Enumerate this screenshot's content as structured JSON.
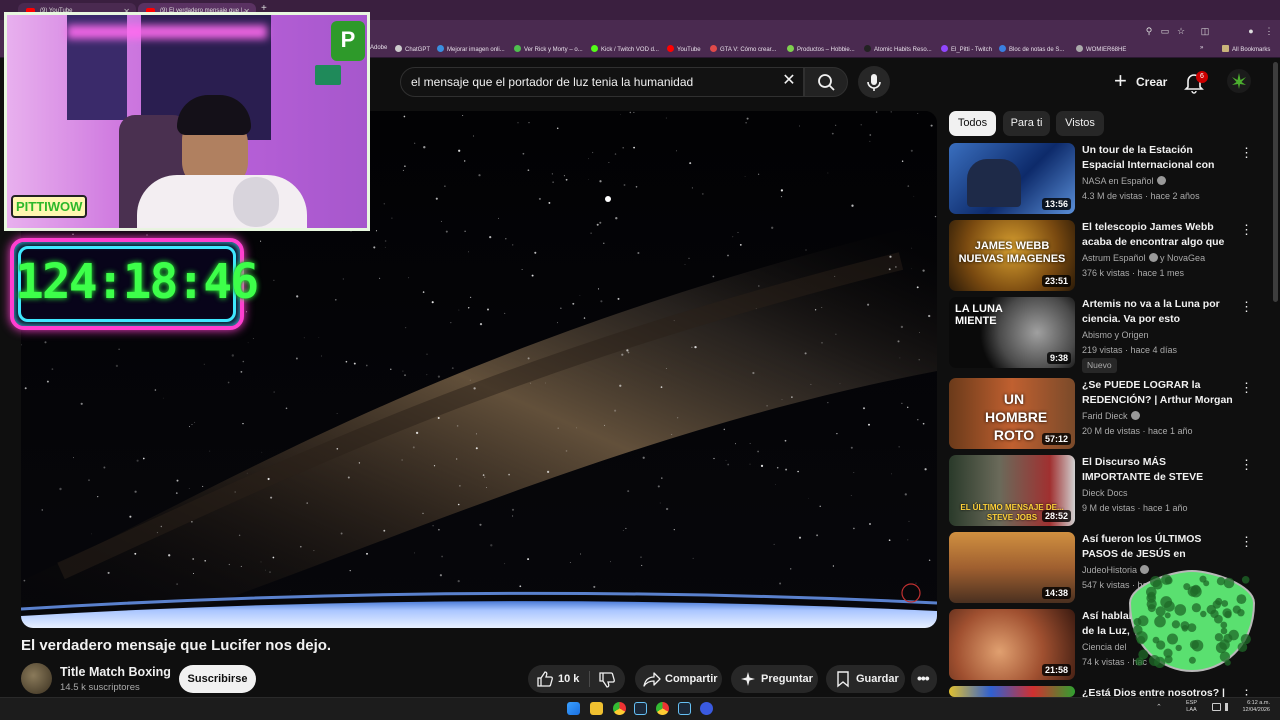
{
  "browser": {
    "tabs": [
      {
        "title": "(9) YouTube"
      },
      {
        "title": "(9) El verdadero mensaje que |..."
      }
    ],
    "bookmarks": [
      {
        "label": "Adobe",
        "color": "#e03a3a"
      },
      {
        "label": "ChatGPT",
        "color": "#cccccc"
      },
      {
        "label": "Mejorar imagen onli...",
        "color": "#3a8fe0"
      },
      {
        "label": "Ver Rick y Morty – o...",
        "color": "#4fbf4f"
      },
      {
        "label": "Kick / Twitch VOD d...",
        "color": "#53fc18"
      },
      {
        "label": "YouTube",
        "color": "#ff0000"
      },
      {
        "label": "GTA V: Cómo crear...",
        "color": "#e04a4a"
      },
      {
        "label": "Productos – Hobbie...",
        "color": "#7fd04f"
      },
      {
        "label": "Atomic Habits Reso...",
        "color": "#222222"
      },
      {
        "label": "El_Pitti - Twitch",
        "color": "#9146ff"
      },
      {
        "label": "Bloc de notas de S...",
        "color": "#3a7fe0"
      },
      {
        "label": "WOMIER68HE",
        "color": "#aaaaaa"
      }
    ],
    "all_bookmarks": "All Bookmarks"
  },
  "header": {
    "search_value": "el mensaje que el portador de luz tenia la humanidad",
    "create_label": "Crear",
    "notification_count": "6"
  },
  "video": {
    "title": "El verdadero mensaje que Lucifer nos dejo.",
    "channel": "Title Match Boxing",
    "subscribers": "14.5 k suscriptores",
    "subscribe_label": "Suscribirse",
    "likes": "10 k",
    "share_label": "Compartir",
    "ask_label": "Preguntar",
    "save_label": "Guardar"
  },
  "chips": [
    "Todos",
    "Para ti",
    "Vistos"
  ],
  "recommendations": [
    {
      "title": "Un tour de la Estación Espacial Internacional con Frank Rubio",
      "channel": "NASA en Español",
      "verified": true,
      "meta": "4.3 M de vistas · hace 2 años",
      "duration": "13:56",
      "thumb_overlay": ""
    },
    {
      "title": "El telescopio James Webb acaba de encontrar algo que N...",
      "channel": "Astrum Español",
      "verified": true,
      "channel_extra": "y NovaGea",
      "meta": "376 k vistas · hace 1 mes",
      "duration": "23:51",
      "thumb_overlay": "JAMES WEBB NUEVAS IMAGENES"
    },
    {
      "title": "Artemis no va a la Luna por ciencia.  Va por esto",
      "channel": "Abismo y Origen",
      "verified": false,
      "meta": "219 vistas · hace 4 días",
      "duration": "9:38",
      "badge": "Nuevo",
      "thumb_overlay": "LA LUNA MIENTE"
    },
    {
      "title": "¿Se PUEDE LOGRAR la REDENCIÓN? | Arthur Morgan ...",
      "channel": "Farid Dieck",
      "verified": true,
      "meta": "20 M de vistas · hace 1 año",
      "duration": "57:12",
      "thumb_overlay": "UN HOMBRE ROTO"
    },
    {
      "title": "El Discurso MÁS IMPORTANTE de STEVE JOBS | Documental",
      "channel": "Dieck Docs",
      "verified": false,
      "meta": "9 M de vistas · hace 1 año",
      "duration": "28:52",
      "thumb_overlay": "EL ÚLTIMO MENSAJE DE... STEVE JOBS"
    },
    {
      "title": "Así fueron los ÚLTIMOS PASOS de JESÚS en JERUSALÉN | La ...",
      "channel": "JudeoHistoria",
      "verified": true,
      "meta": "547 k vistas · hac",
      "duration": "14:38",
      "thumb_overlay": ""
    },
    {
      "title": "Así hablab de la Luz,",
      "channel": "Ciencia del",
      "verified": false,
      "meta": "74 k vistas · hac",
      "duration": "21:58",
      "thumb_overlay": ""
    },
    {
      "title": "¿Está Dios entre nosotros? | La ...",
      "channel": "",
      "verified": false,
      "meta": "",
      "duration": "",
      "thumb_overlay": ""
    }
  ],
  "overlay": {
    "timer": "124:18:46",
    "webcam_logo": "PITTIWOW",
    "corner_logo": "P"
  },
  "tray": {
    "lang": "ESP\nLAA",
    "time": "6:12 a.m.",
    "date": "12/04/2026"
  },
  "colors": {
    "background": "#0f0f0f",
    "accent_red": "#ff0000",
    "timer_green": "#3dff4a",
    "neon_pink": "#ff3fd0",
    "neon_cyan": "#3fe8ff"
  }
}
